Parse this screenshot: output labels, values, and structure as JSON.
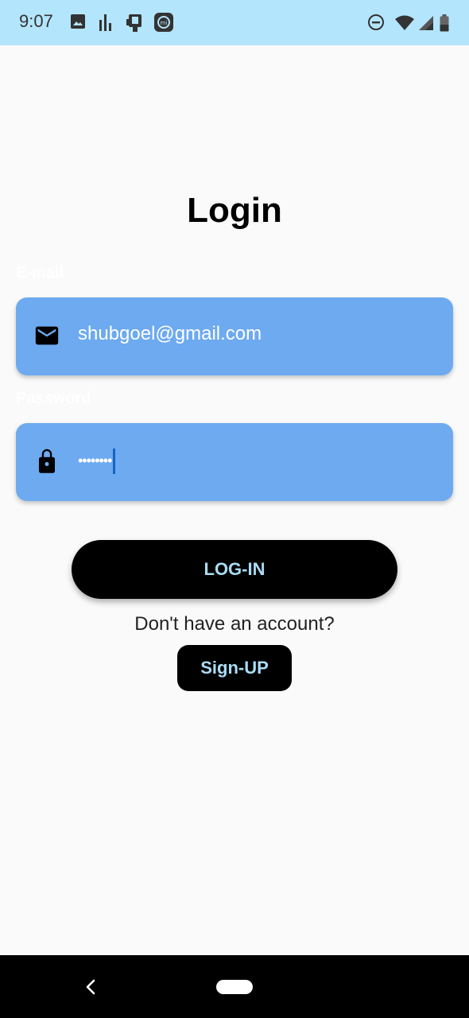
{
  "status_bar": {
    "time": "9:07",
    "left_icons": [
      "image-icon",
      "bar-chart-icon",
      "screen-cast-icon",
      "mi-app-icon"
    ],
    "right_icons": [
      "dnd-icon",
      "wifi-icon",
      "signal-icon",
      "battery-icon"
    ],
    "background_color": "#b3e5fc"
  },
  "login": {
    "title": "Login",
    "email": {
      "label": "E-mail",
      "value": "shubgoel@gmail.com",
      "icon": "mail-icon"
    },
    "password": {
      "label": "Password",
      "value": "••••••••",
      "icon": "lock-icon"
    },
    "login_button": "LOG-IN",
    "no_account_text": "Don't have an account?",
    "signup_button": "Sign-UP"
  },
  "colors": {
    "field_bg": "#6daaf0",
    "button_bg": "#000000",
    "button_text": "#a9dcf5"
  },
  "nav_bar": {
    "icons": [
      "back-icon",
      "home-pill-icon"
    ]
  }
}
